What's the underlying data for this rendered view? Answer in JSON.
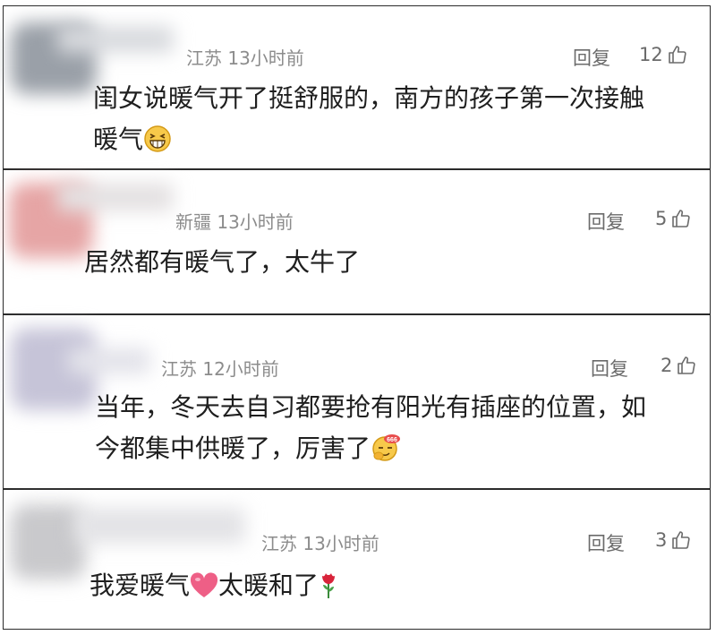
{
  "comments": [
    {
      "location": "江苏",
      "time": "13小时前",
      "reply_label": "回复",
      "like_count": "12",
      "text_line1": "闺女说暖气开了挺舒服的，南方的孩子第一次接触",
      "text_line2": "暖气",
      "trailing_emoji": "grinning-squint-emoji"
    },
    {
      "location": "新疆",
      "time": "13小时前",
      "reply_label": "回复",
      "like_count": "5",
      "text_line1": "居然都有暖气了，太牛了"
    },
    {
      "location": "江苏",
      "time": "12小时前",
      "reply_label": "回复",
      "like_count": "2",
      "text_line1": "当年，冬天去自习都要抢有阳光有插座的位置，如",
      "text_line2": "今都集中供暖了，厉害了",
      "trailing_emoji": "666-emoji"
    },
    {
      "location": "江苏",
      "time": "13小时前",
      "reply_label": "回复",
      "like_count": "3",
      "text_part1": "我爱暖气",
      "text_part2": "太暖和了",
      "inline_emoji_1": "heart-emoji",
      "inline_emoji_2": "rose-emoji"
    }
  ],
  "colors": {
    "meta": "#8c8c8c",
    "body_text": "#1f1f1f",
    "action": "#6b6b6b",
    "border": "#2b2b2b"
  }
}
